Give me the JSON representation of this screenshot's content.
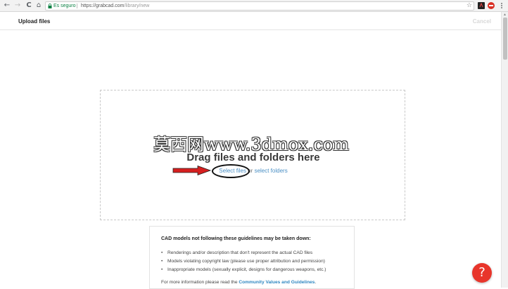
{
  "browser": {
    "back": "←",
    "forward": "→",
    "reload": "C",
    "home": "⌂",
    "secure_label": "Es seguro",
    "url_host": "https://grabcad.com",
    "url_path": "/library/new",
    "star": "☆"
  },
  "header": {
    "title": "Upload files",
    "cancel_label": "Cancel"
  },
  "dropzone": {
    "title": "Drag files and folders here",
    "select_files": "Select files",
    "or_text": "or",
    "select_folders": "select folders"
  },
  "watermark": "莫西网www.3dmox.com",
  "guidelines": {
    "title": "CAD models not following these guidelines may be taken down:",
    "items": [
      "Renderings and/or description that don't represent the actual CAD files",
      "Models violating copyright law (please use proper attribution and permission)",
      "Inappropriate models (sexually explicit, designs for dangerous weapons, etc.)"
    ],
    "more_prefix": "For more information please read the",
    "more_link": "Community Values and Guidelines",
    "more_suffix": "."
  },
  "help": {
    "icon": "?"
  },
  "colors": {
    "accent_red": "#e8352b",
    "link_blue": "#4a8fc4",
    "annotation_arrow": "#d61f1f"
  }
}
